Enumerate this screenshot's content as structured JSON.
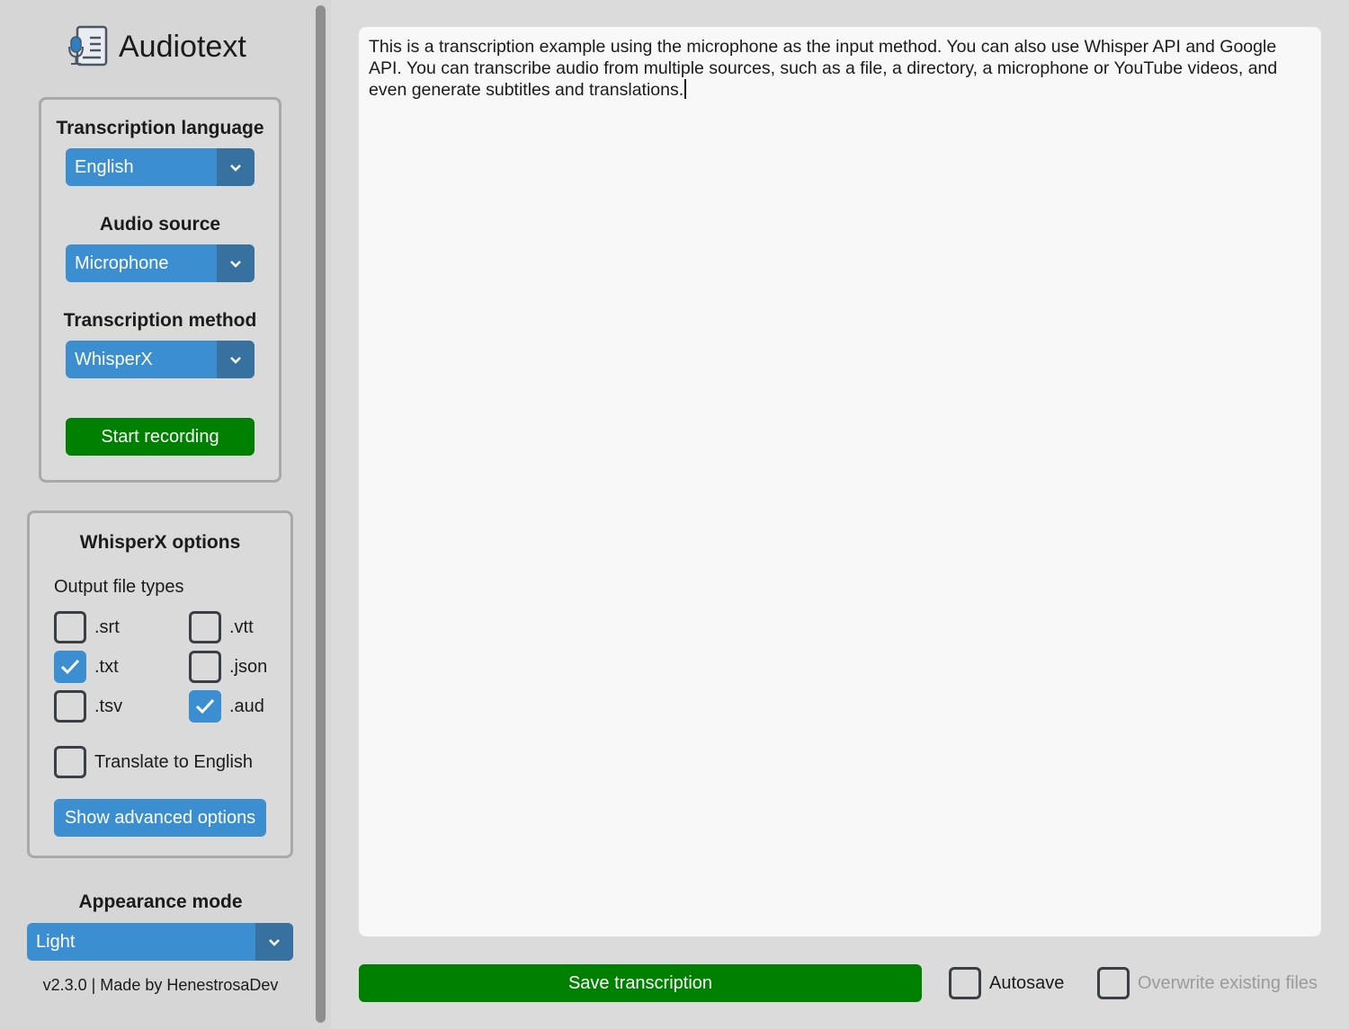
{
  "app": {
    "title": "Audiotext",
    "logo_icon": "document-microphone-icon",
    "version_text": "v2.3.0 | Made by HenestrosaDev"
  },
  "main_panel": {
    "language_label": "Transcription language",
    "language_value": "English",
    "source_label": "Audio source",
    "source_value": "Microphone",
    "method_label": "Transcription method",
    "method_value": "WhisperX",
    "start_button": "Start recording"
  },
  "whisperx_options": {
    "title": "WhisperX options",
    "output_label": "Output file types",
    "file_types": [
      {
        "label": ".srt",
        "checked": false
      },
      {
        "label": ".vtt",
        "checked": false
      },
      {
        "label": ".txt",
        "checked": true
      },
      {
        "label": ".json",
        "checked": false
      },
      {
        "label": ".tsv",
        "checked": false
      },
      {
        "label": ".aud",
        "checked": true
      }
    ],
    "translate_label": "Translate to English",
    "translate_checked": false,
    "advanced_button": "Show advanced options"
  },
  "appearance": {
    "label": "Appearance mode",
    "value": "Light"
  },
  "transcription": {
    "text": "This is a transcription example using the microphone as the input method. You can also use Whisper API and Google API. You can transcribe audio from multiple sources, such as a file, a directory, a microphone or YouTube videos, and even generate subtitles and translations."
  },
  "footer": {
    "save_button": "Save transcription",
    "autosave_label": "Autosave",
    "autosave_checked": false,
    "overwrite_label": "Overwrite existing files",
    "overwrite_checked": false,
    "overwrite_disabled": true
  },
  "colors": {
    "accent": "#3b8ed0",
    "accent_dark": "#36719f",
    "green": "#008000",
    "background": "#d6d6d6",
    "textbox": "#f8f8f8"
  }
}
